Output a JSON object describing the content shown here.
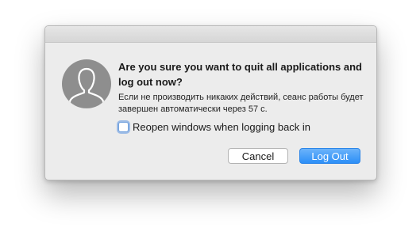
{
  "dialog": {
    "title": "Are you sure you want to quit all applications and log out now?",
    "info": "Если не производить никаких действий, сеанс работы будет завершен автоматически через 57 с.",
    "checkbox": {
      "label": "Reopen windows when logging back in",
      "checked": false
    },
    "buttons": {
      "cancel_label": "Cancel",
      "logout_label": "Log Out"
    },
    "icons": {
      "avatar": "user-avatar-icon"
    },
    "colors": {
      "accent": "#2c8ff7",
      "background": "#ececec"
    }
  }
}
